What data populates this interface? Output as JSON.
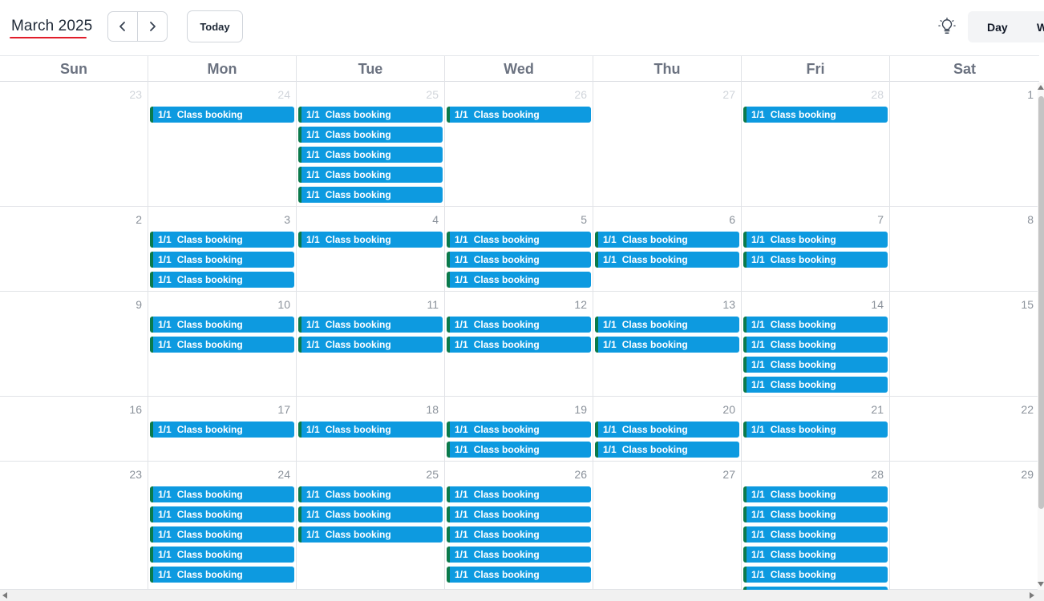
{
  "header": {
    "title": "March 2025",
    "today_label": "Today",
    "prev_icon": "chevron-left-icon",
    "next_icon": "chevron-right-icon",
    "theme_icon": "lightbulb-icon",
    "views": [
      "Day",
      "W"
    ]
  },
  "colors": {
    "event_bg": "#0d9ae0",
    "event_stripe": "#0b7a4b",
    "title_underline": "#e11d2a"
  },
  "weekdays": [
    "Sun",
    "Mon",
    "Tue",
    "Wed",
    "Thu",
    "Fri",
    "Sat"
  ],
  "event_label": {
    "prefix": "1/1",
    "title": "Class booking"
  },
  "weeks": [
    {
      "days": [
        {
          "num": "23",
          "other": true,
          "events": 0
        },
        {
          "num": "24",
          "other": true,
          "events": 1
        },
        {
          "num": "25",
          "other": true,
          "events": 5
        },
        {
          "num": "26",
          "other": true,
          "events": 1
        },
        {
          "num": "27",
          "other": true,
          "events": 0
        },
        {
          "num": "28",
          "other": true,
          "events": 1
        },
        {
          "num": "1",
          "other": false,
          "events": 0
        }
      ]
    },
    {
      "days": [
        {
          "num": "2",
          "other": false,
          "events": 0
        },
        {
          "num": "3",
          "other": false,
          "events": 3
        },
        {
          "num": "4",
          "other": false,
          "events": 1
        },
        {
          "num": "5",
          "other": false,
          "events": 3
        },
        {
          "num": "6",
          "other": false,
          "events": 2
        },
        {
          "num": "7",
          "other": false,
          "events": 2
        },
        {
          "num": "8",
          "other": false,
          "events": 0
        }
      ]
    },
    {
      "days": [
        {
          "num": "9",
          "other": false,
          "events": 0
        },
        {
          "num": "10",
          "other": false,
          "events": 2
        },
        {
          "num": "11",
          "other": false,
          "events": 2
        },
        {
          "num": "12",
          "other": false,
          "events": 2
        },
        {
          "num": "13",
          "other": false,
          "events": 2
        },
        {
          "num": "14",
          "other": false,
          "events": 4
        },
        {
          "num": "15",
          "other": false,
          "events": 0
        }
      ]
    },
    {
      "days": [
        {
          "num": "16",
          "other": false,
          "events": 0
        },
        {
          "num": "17",
          "other": false,
          "events": 1
        },
        {
          "num": "18",
          "other": false,
          "events": 1
        },
        {
          "num": "19",
          "other": false,
          "events": 2
        },
        {
          "num": "20",
          "other": false,
          "events": 2
        },
        {
          "num": "21",
          "other": false,
          "events": 1
        },
        {
          "num": "22",
          "other": false,
          "events": 0
        }
      ]
    },
    {
      "days": [
        {
          "num": "23",
          "other": false,
          "events": 0
        },
        {
          "num": "24",
          "other": false,
          "events": 5
        },
        {
          "num": "25",
          "other": false,
          "events": 3
        },
        {
          "num": "26",
          "other": false,
          "events": 5
        },
        {
          "num": "27",
          "other": false,
          "events": 0
        },
        {
          "num": "28",
          "other": false,
          "events": 6
        },
        {
          "num": "29",
          "other": false,
          "events": 0
        }
      ]
    }
  ]
}
